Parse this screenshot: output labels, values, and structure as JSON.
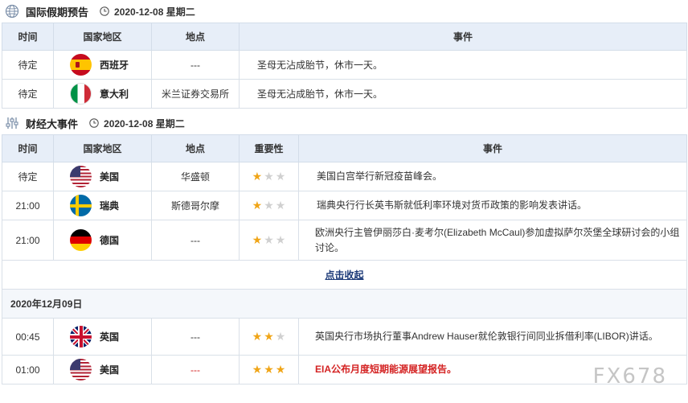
{
  "holiday_section": {
    "title": "国际假期预告",
    "date": "2020-12-08 星期二",
    "headers": {
      "time": "时间",
      "country": "国家地区",
      "place": "地点",
      "event": "事件"
    },
    "rows": [
      {
        "time": "待定",
        "country": "西班牙",
        "flag": "spain-flag",
        "place": "---",
        "event": "圣母无沾成胎节，休市一天。"
      },
      {
        "time": "待定",
        "country": "意大利",
        "flag": "italy-flag",
        "place": "米兰证券交易所",
        "event": "圣母无沾成胎节，休市一天。"
      }
    ]
  },
  "events_section": {
    "title": "财经大事件",
    "date": "2020-12-08 星期二",
    "headers": {
      "time": "时间",
      "country": "国家地区",
      "place": "地点",
      "importance": "重要性",
      "event": "事件"
    },
    "rows": [
      {
        "time": "待定",
        "country": "美国",
        "flag": "usa-flag",
        "place": "华盛顿",
        "stars": 1,
        "event": "美国白宫举行新冠疫苗峰会。"
      },
      {
        "time": "21:00",
        "country": "瑞典",
        "flag": "sweden-flag",
        "place": "斯德哥尔摩",
        "stars": 1,
        "event": "瑞典央行行长英韦斯就低利率环境对货币政策的影响发表讲话。"
      },
      {
        "time": "21:00",
        "country": "德国",
        "flag": "germany-flag",
        "place": "---",
        "stars": 1,
        "event": "欧洲央行主管伊丽莎白·麦考尔(Elizabeth McCaul)参加虚拟萨尔茨堡全球研讨会的小组讨论。"
      }
    ],
    "collapse_label": "点击收起",
    "next_date": "2020年12月09日",
    "next_rows": [
      {
        "time": "00:45",
        "country": "英国",
        "flag": "uk-flag",
        "place": "---",
        "stars": 2,
        "event": "英国央行市场执行董事Andrew Hauser就伦敦银行间同业拆借利率(LIBOR)讲话。"
      },
      {
        "time": "01:00",
        "country": "美国",
        "flag": "usa-flag",
        "place": "---",
        "stars": 3,
        "event": "EIA公布月度短期能源展望报告。"
      }
    ]
  },
  "watermark": "FX678",
  "colors": {
    "header_bg": "#e7eef8",
    "star_on": "#f0a517",
    "star_off": "#d0d0d0",
    "highlight": "#d42323",
    "link": "#1c3a78"
  }
}
